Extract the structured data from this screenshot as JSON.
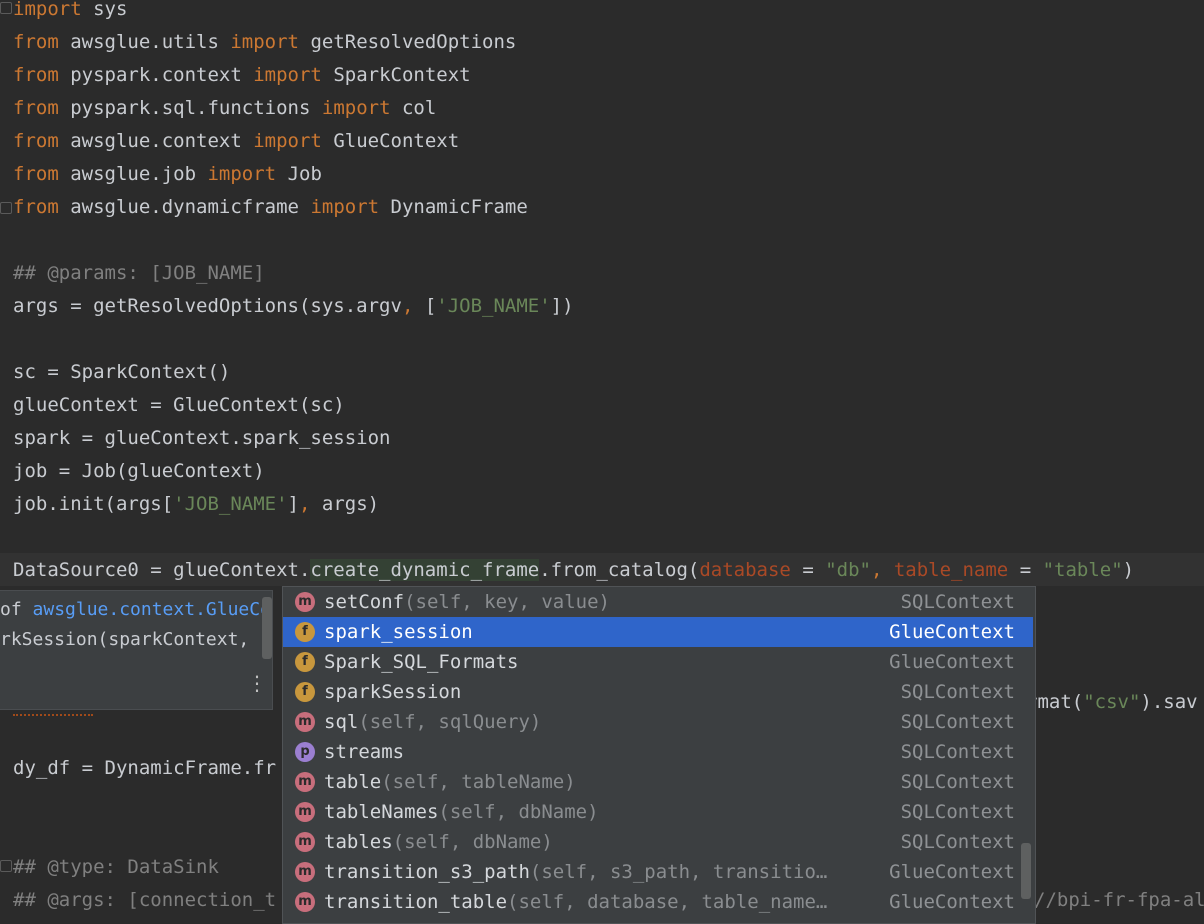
{
  "editor": {
    "lines": {
      "l0": {
        "kw": "import",
        "rest": " sys"
      },
      "l1": {
        "kw": "from",
        "mod": " awsglue.utils ",
        "kw2": "import",
        "rest": " getResolvedOptions"
      },
      "l2": {
        "kw": "from",
        "mod": " pyspark.context ",
        "kw2": "import",
        "rest": " SparkContext"
      },
      "l3": {
        "kw": "from",
        "mod": " pyspark.sql.functions ",
        "kw2": "import",
        "rest": " col"
      },
      "l4": {
        "kw": "from",
        "mod": " awsglue.context ",
        "kw2": "import",
        "rest": " GlueContext"
      },
      "l5": {
        "kw": "from",
        "mod": " awsglue.job ",
        "kw2": "import",
        "rest": " Job"
      },
      "l6": {
        "kw": "from",
        "mod": " awsglue.dynamicframe ",
        "kw2": "import",
        "rest": " DynamicFrame"
      },
      "l8": {
        "text": "## @params: [JOB_NAME]"
      },
      "l9": {
        "a": "args = getResolvedOptions(sys.argv",
        "comma": ",",
        "b": " [",
        "s": "'JOB_NAME'",
        "c": "])"
      },
      "l11": {
        "text": "sc = SparkContext()"
      },
      "l12": {
        "text": "glueContext = GlueContext(sc)"
      },
      "l13": {
        "text": "spark = glueContext.spark_session"
      },
      "l14": {
        "text": "job = Job(glueContext)"
      },
      "l15": {
        "a": "job.init(args[",
        "s": "'JOB_NAME'",
        "b": "]",
        "comma": ",",
        "c": " args)"
      },
      "l17": {
        "a": "DataSource0 = glueContext.",
        "m": "create_dynamic_frame",
        "b": ".from_catalog(",
        "p1": "database",
        "e1": " = ",
        "s1": "\"db\"",
        "comma": ",",
        "p2": " table_name",
        "e2": " = ",
        "s2": "\"table\"",
        "c": ")"
      },
      "l20": {
        "a": "rmat(",
        "s": "\"csv\"",
        "b": ").sav"
      },
      "l22": {
        "text": "dy_df = DynamicFrame.fr"
      },
      "l25": {
        "text": "## @type: DataSink"
      },
      "l26": {
        "text": "## @args: [connection_t"
      },
      "l26r": {
        "text": "//bpi-fr-fpa-al"
      }
    }
  },
  "doc_popup": {
    "line1_prefix": "of ",
    "line1_link": "awsglue.context.GlueCo",
    "line2": "rkSession(sparkContext, s",
    "more_icon": "vertical-ellipsis-icon"
  },
  "completion": {
    "items": [
      {
        "kind": "m",
        "name": "setConf",
        "sig": "(self, key, value)",
        "type": "SQLContext"
      },
      {
        "kind": "f",
        "name": "spark_session",
        "sig": "",
        "type": "GlueContext"
      },
      {
        "kind": "f",
        "name": "Spark_SQL_Formats",
        "sig": "",
        "type": "GlueContext"
      },
      {
        "kind": "f",
        "name": "sparkSession",
        "sig": "",
        "type": "SQLContext"
      },
      {
        "kind": "m",
        "name": "sql",
        "sig": "(self, sqlQuery)",
        "type": "SQLContext"
      },
      {
        "kind": "p",
        "name": "streams",
        "sig": "",
        "type": "SQLContext"
      },
      {
        "kind": "m",
        "name": "table",
        "sig": "(self, tableName)",
        "type": "SQLContext"
      },
      {
        "kind": "m",
        "name": "tableNames",
        "sig": "(self, dbName)",
        "type": "SQLContext"
      },
      {
        "kind": "m",
        "name": "tables",
        "sig": "(self, dbName)",
        "type": "SQLContext"
      },
      {
        "kind": "m",
        "name": "transition_s3_path",
        "sig": "(self, s3_path, transitio…",
        "type": "GlueContext"
      },
      {
        "kind": "m",
        "name": "transition_table",
        "sig": "(self, database, table_name…",
        "type": "GlueContext"
      }
    ],
    "selected_index": 1
  },
  "colors": {
    "background": "#2b2b2b",
    "keyword": "#cc7832",
    "string": "#6a8759",
    "comment": "#808080",
    "selection": "#2f65ca",
    "popup": "#3c3f41"
  }
}
